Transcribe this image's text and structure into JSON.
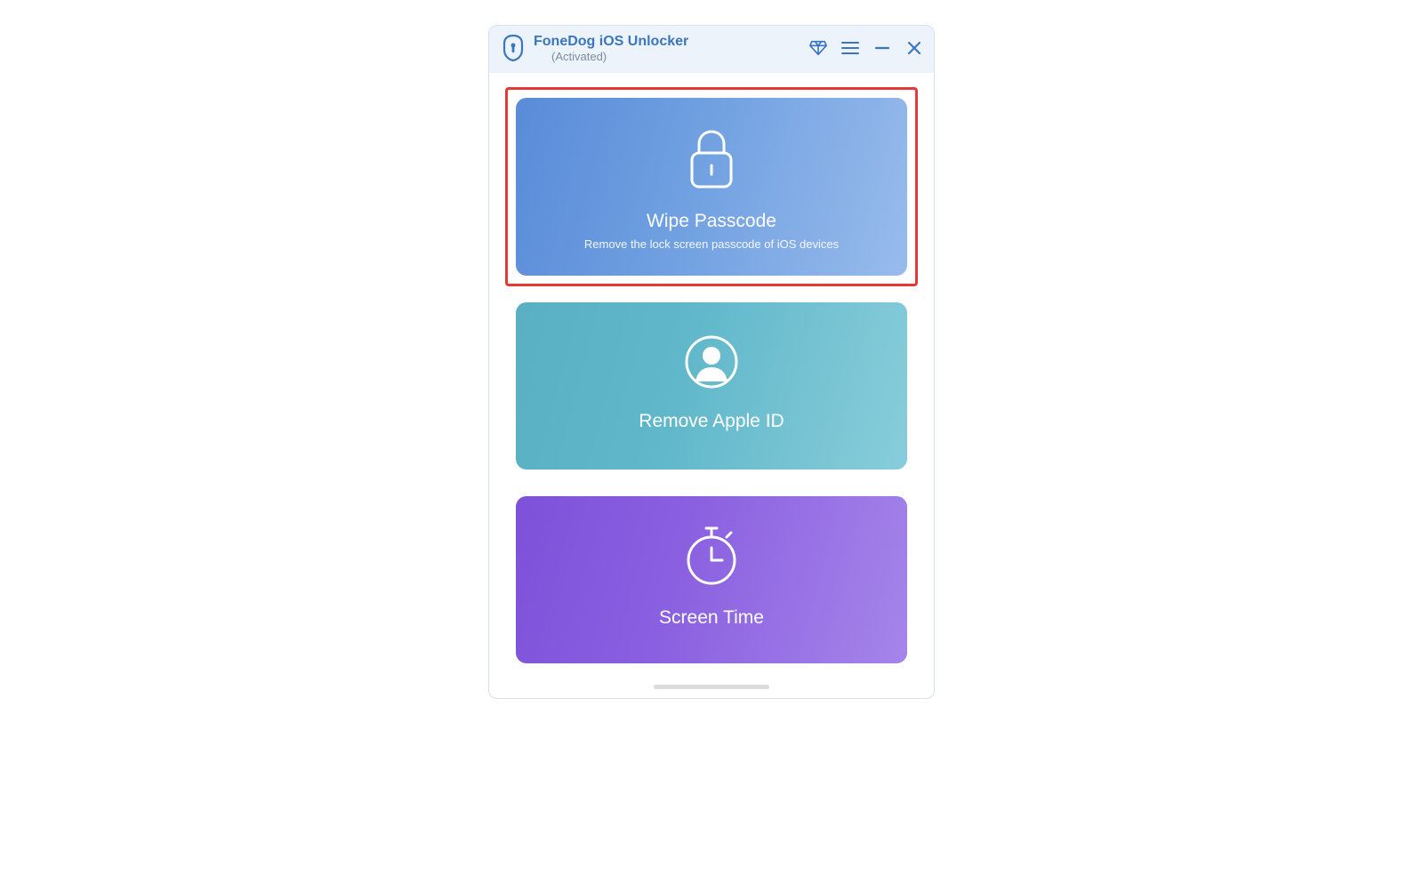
{
  "header": {
    "title": "FoneDog iOS Unlocker",
    "status": "(Activated)"
  },
  "cards": {
    "wipe": {
      "title": "Wipe Passcode",
      "subtitle": "Remove the lock screen passcode of iOS devices"
    },
    "appleId": {
      "title": "Remove Apple ID"
    },
    "screenTime": {
      "title": "Screen Time"
    }
  }
}
